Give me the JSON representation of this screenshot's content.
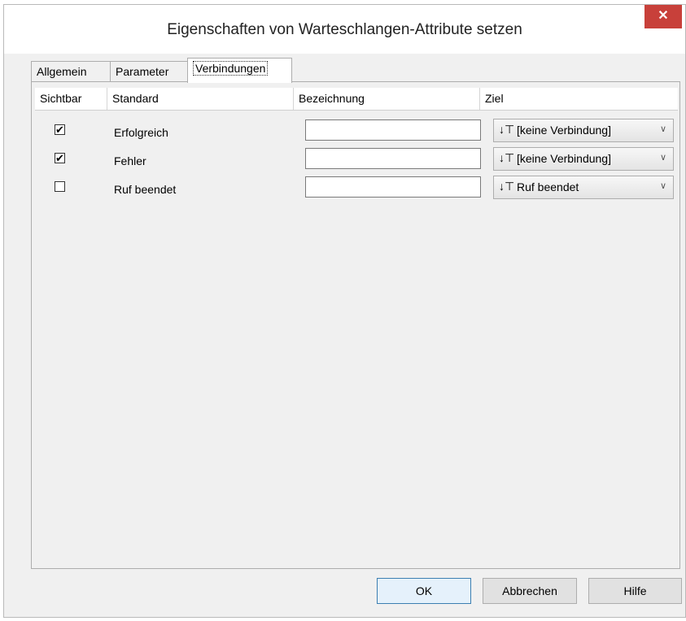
{
  "window": {
    "title": "Eigenschaften von Warteschlangen-Attribute setzen",
    "close_glyph": "✕"
  },
  "tabs": [
    {
      "label": "Allgemein",
      "active": false
    },
    {
      "label": "Parameter",
      "active": false
    },
    {
      "label": "Verbindungen",
      "active": true
    }
  ],
  "table": {
    "columns": [
      "Sichtbar",
      "Standard",
      "Bezeichnung",
      "Ziel"
    ],
    "rows": [
      {
        "visible": true,
        "checkmark": "✔",
        "standard": "Erfolgreich",
        "bezeichnung": "",
        "ziel": "[keine Verbindung]"
      },
      {
        "visible": true,
        "checkmark": "✔",
        "standard": "Fehler",
        "bezeichnung": "",
        "ziel": "[keine Verbindung]"
      },
      {
        "visible": false,
        "checkmark": "",
        "standard": "Ruf beendet",
        "bezeichnung": "",
        "ziel": "Ruf beendet"
      }
    ]
  },
  "icons": {
    "ziel_icon": "↓⊤",
    "chevron": "∨"
  },
  "buttons": {
    "ok": "OK",
    "cancel": "Abbrechen",
    "help": "Hilfe"
  },
  "colors": {
    "close": "#c8403a",
    "default_button_border": "#3c7fb1"
  }
}
